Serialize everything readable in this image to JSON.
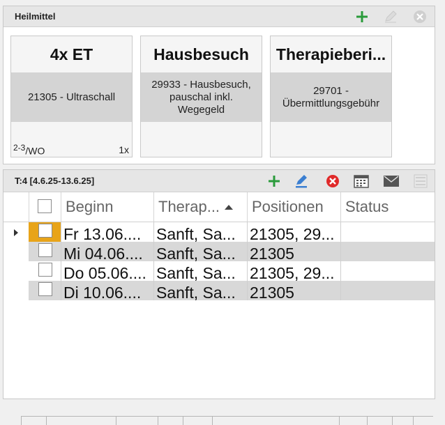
{
  "heilmittel": {
    "title": "Heilmittel",
    "tools": {
      "add": "plus-icon",
      "edit": "pencil-icon",
      "remove": "close-circle-icon"
    },
    "cards": [
      {
        "title": "4x ET",
        "body": "21305 - Ultraschall",
        "freq_main": "2-3",
        "freq_suffix": "/WO",
        "count": "1x"
      },
      {
        "title": "Hausbesuch",
        "body": "29933 - Hausbesuch, pauschal inkl. Wegegeld"
      },
      {
        "title": "Therapieberi...",
        "body": "29701 - Übermittlungsgebühr"
      }
    ]
  },
  "termine": {
    "title": "T:4 [4.6.25-13.6.25]",
    "tools": {
      "add": "plus-icon",
      "edit": "pencil-icon",
      "delete": "red-x-icon",
      "calendar": "calendar-icon",
      "mail": "mail-icon",
      "list": "list-icon"
    },
    "columns": {
      "beginn": "Beginn",
      "therapeut": "Therap...",
      "positionen": "Positionen",
      "status": "Status"
    },
    "rows": [
      {
        "beginn": "Fr 13.06....",
        "therapeut": "Sanft, Sa...",
        "positionen": "21305, 29...",
        "status": ""
      },
      {
        "beginn": "Mi 04.06....",
        "therapeut": "Sanft, Sa...",
        "positionen": "21305",
        "status": ""
      },
      {
        "beginn": "Do 05.06....",
        "therapeut": "Sanft, Sa...",
        "positionen": "21305, 29...",
        "status": ""
      },
      {
        "beginn": "Di 10.06....",
        "therapeut": "Sanft, Sa...",
        "positionen": "21305",
        "status": ""
      }
    ]
  }
}
